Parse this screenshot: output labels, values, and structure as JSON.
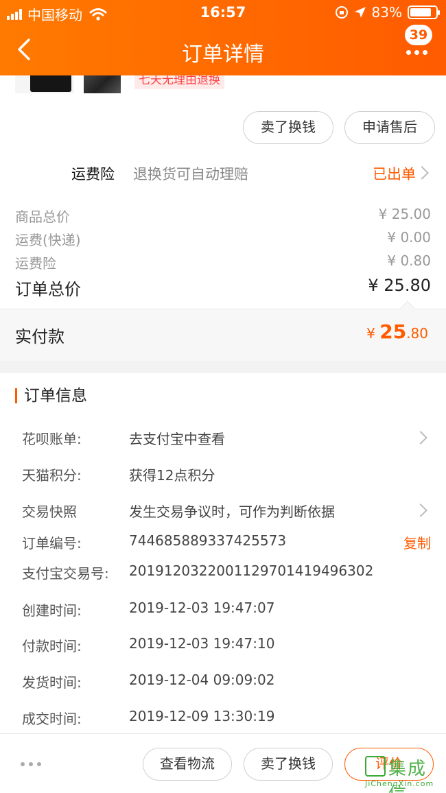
{
  "status_bar": {
    "carrier": "中国移动",
    "time": "16:57",
    "battery": "83%",
    "battery_level": 0.83
  },
  "nav": {
    "title": "订单详情",
    "badge": "39"
  },
  "product": {
    "tag": "七天无理由退换"
  },
  "actions_top": {
    "sell_label": "卖了换钱",
    "after_sale_label": "申请售后"
  },
  "insurance": {
    "label": "运费险",
    "desc": "退换货可自动理赔",
    "status": "已出单"
  },
  "prices": [
    {
      "label": "商品总价",
      "value": "¥ 25.00"
    },
    {
      "label": "运费(快递)",
      "value": "¥ 0.00"
    },
    {
      "label": "运费险",
      "value": "¥ 0.80"
    }
  ],
  "order_total": {
    "label": "订单总价",
    "value": "¥ 25.80"
  },
  "paid": {
    "label": "实付款",
    "currency": "¥",
    "integer": "25",
    "decimal": ".80"
  },
  "order_info": {
    "title": "订单信息",
    "rows": [
      {
        "key": "花呗账单:",
        "value": "去支付宝中查看"
      },
      {
        "key": "天猫积分:",
        "value": "获得12点积分"
      },
      {
        "key": "交易快照",
        "value": "发生交易争议时，可作为判断依据"
      },
      {
        "key": "订单编号:",
        "value": "744685889337425573",
        "action": "复制"
      },
      {
        "key": "支付宝交易号:",
        "value": "2019120322001129701419496302"
      },
      {
        "key": "创建时间:",
        "value": "2019-12-03 19:47:07"
      },
      {
        "key": "付款时间:",
        "value": "2019-12-03 19:47:10"
      },
      {
        "key": "发货时间:",
        "value": "2019-12-04 09:09:02"
      },
      {
        "key": "成交时间:",
        "value": "2019-12-09 13:30:19"
      }
    ]
  },
  "bottom_bar": {
    "logistics_label": "查看物流",
    "sell_label": "卖了换钱",
    "review_label": "评价"
  },
  "watermark": {
    "text": "集成信",
    "sub": "JiChengXin.com"
  },
  "colors": {
    "accent": "#ff5b00",
    "header_start": "#ff7a00",
    "watermark": "#3aa935"
  }
}
